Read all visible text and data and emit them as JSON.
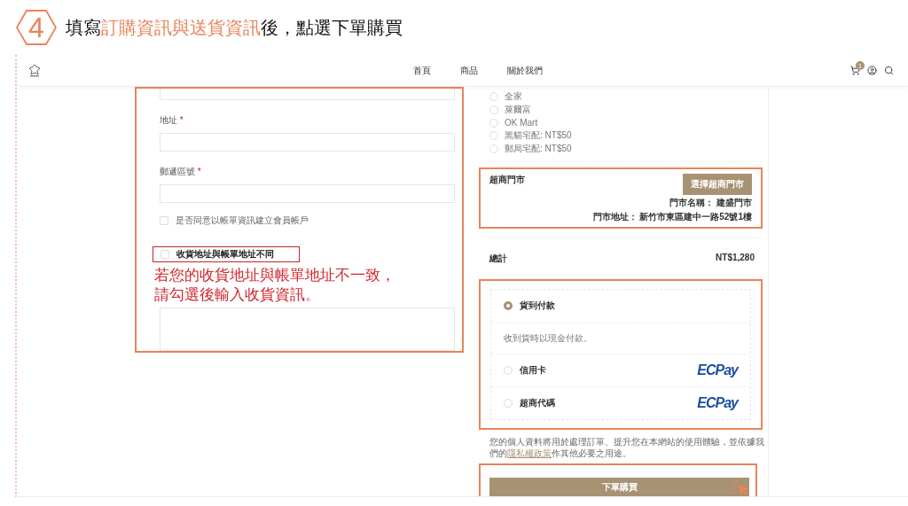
{
  "step": {
    "number": "4",
    "title": [
      {
        "text": "填寫",
        "highlight": false
      },
      {
        "text": "訂購資訊與送貨資訊",
        "highlight": true
      },
      {
        "text": "後，點選下單購買",
        "highlight": false
      }
    ]
  },
  "nav": {
    "links": [
      "首頁",
      "商品",
      "關於我們"
    ],
    "cart_count": "1"
  },
  "billing": {
    "fields": [
      {
        "label": "地址",
        "mark": "*"
      },
      {
        "label": "郵遞區號",
        "mark": "*"
      }
    ],
    "create_account": {
      "label": "是否同意以帳單資訊建立會員帳戶",
      "checked": false
    },
    "ship_different": {
      "label": "收貨地址與帳單地址不同",
      "checked": false
    },
    "annotation": [
      "若您的收貨地址與帳單地址不一致，",
      "請勾選後輸入收貨資訊。"
    ]
  },
  "shipping": {
    "options": [
      {
        "label": "全家",
        "selected": false
      },
      {
        "label": "萊爾富",
        "selected": false
      },
      {
        "label": "OK Mart",
        "selected": false
      },
      {
        "label": "黑貓宅配: NT$50",
        "selected": false
      },
      {
        "label": "郵局宅配: NT$50",
        "selected": false
      }
    ]
  },
  "store": {
    "heading": "超商門市",
    "button": "選擇超商門市",
    "name": "門市名稱： 建盛門市",
    "address": "門市地址： 新竹市東區建中一路52號1樓"
  },
  "total": {
    "label": "總計",
    "value": "NT$1,280"
  },
  "payment": {
    "methods": [
      {
        "label": "貨到付款",
        "selected": true,
        "description": "收到貨時以現金付款。"
      },
      {
        "label": "信用卡",
        "selected": false,
        "logo": "ECPay"
      },
      {
        "label": "超商代碼",
        "selected": false,
        "logo": "ECPay"
      }
    ]
  },
  "privacy": {
    "before": "您的個人資料將用於處理訂單、提升您在本網站的使用體驗，並依據我們的",
    "link": "隱私權政策",
    "after": "作其他必要之用途。"
  },
  "submit": "下單購買"
}
